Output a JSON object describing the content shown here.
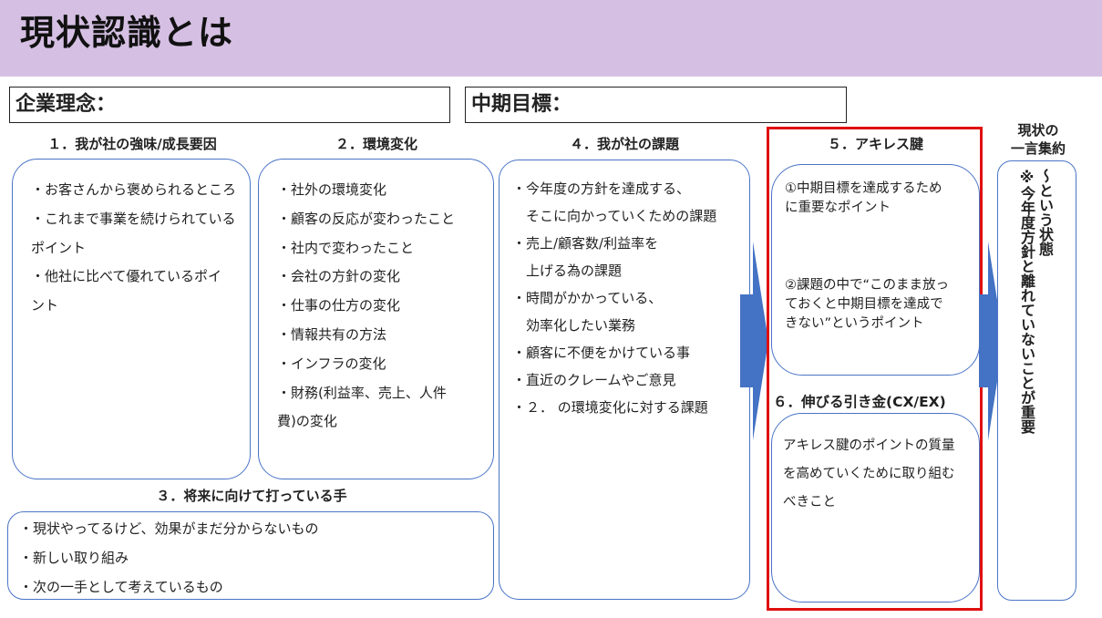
{
  "title": "現状認識とは",
  "philosophy_label": "企業理念：",
  "midterm_label": "中期目標：",
  "sections": {
    "strength": {
      "title": "１．我が社の強味/成長要因",
      "lines": [
        "・お客さんから褒められるところ",
        "・これまで事業を続けられている",
        "ポイント",
        "・他社に比べて優れているポイ",
        "ント"
      ]
    },
    "environment": {
      "title": "２．環境変化",
      "lines": [
        "・社外の環境変化",
        "・顧客の反応が変わったこと",
        "・社内で変わったこと",
        "・会社の方針の変化",
        "・仕事の仕方の変化",
        "・情報共有の方法",
        "・インフラの変化",
        "・財務(利益率、売上、人件",
        "費)の変化"
      ]
    },
    "future": {
      "title": "３．将来に向けて打っている手",
      "lines": [
        "・現状やってるけど、効果がまだ分からないもの",
        "・新しい取り組み",
        "・次の一手として考えているもの"
      ]
    },
    "issues": {
      "title": "４．我が社の課題",
      "lines": [
        "・今年度の方針を達成する、",
        "　そこに向かっていくための課題",
        "",
        "・売上/顧客数/利益率を",
        "　上げる為の課題",
        "",
        "・時間がかかっている、",
        "　効率化したい業務",
        "",
        "・顧客に不便をかけている事",
        "",
        "・直近のクレームやご意見",
        "",
        "・２． の環境変化に対する課題"
      ]
    },
    "achilles": {
      "title": "５．アキレス腱",
      "point1": "①中期目標を達成するため\nに重要なポイント",
      "point2": "②課題の中で“このまま放っ\nておくと中期目標を達成で\nきない”というポイント"
    },
    "trigger": {
      "title": "６．伸びる引き金(CX/EX)",
      "text": "アキレス腱のポイントの質量\nを高めていくために取り組む\nべきこと"
    },
    "summary": {
      "title_line1": "現状の",
      "title_line2": "一言集約",
      "vertical": "～という状態\n※今年度方針と離れていないことが重要"
    }
  },
  "colors": {
    "header_band": "#d5c0e3",
    "box_border": "#4a74c6",
    "arrow": "#4472c4",
    "highlight_border": "#e01010"
  }
}
